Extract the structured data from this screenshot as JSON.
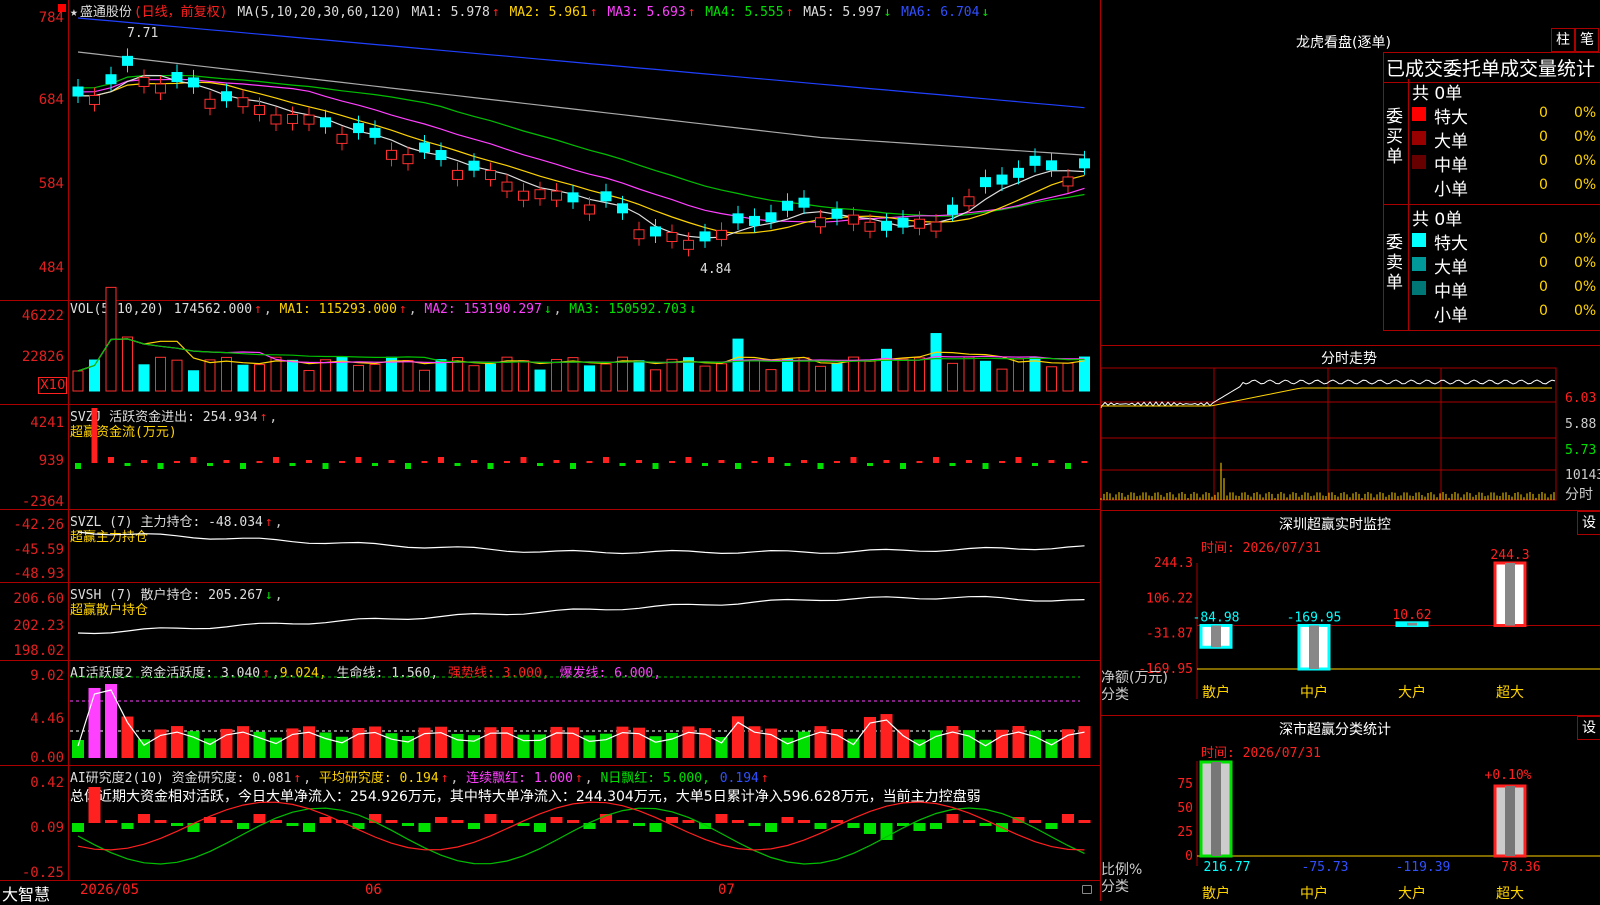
{
  "stock": {
    "star": "★",
    "name": "盛通股份",
    "period": "(日线，前复权)",
    "ma_def": "MA(5,10,20,30,60,120)"
  },
  "ma_header": [
    {
      "label": "MA1:",
      "value": "5.978",
      "arrow": "↑",
      "color": "#dddddd"
    },
    {
      "label": "MA2:",
      "value": "5.961",
      "arrow": "↑",
      "color": "#ffd400"
    },
    {
      "label": "MA3:",
      "value": "5.693",
      "arrow": "↑",
      "color": "#ff40ff"
    },
    {
      "label": "MA4:",
      "value": "5.555",
      "arrow": "↑",
      "color": "#00e000"
    },
    {
      "label": "MA5:",
      "value": "5.997",
      "arrow": "↓",
      "color": "#dddddd"
    },
    {
      "label": "MA6:",
      "value": "6.704",
      "arrow": "↓",
      "color": "#3050ff"
    }
  ],
  "price_axis": [
    "784",
    "684",
    "584",
    "484"
  ],
  "price_marks": {
    "high": "7.71",
    "low": "4.84"
  },
  "vol_header": {
    "title": "VOL(5,10,20)",
    "vol": "174562.000",
    "ma1": "MA1: 115293.000",
    "ma2": "MA2: 153190.297",
    "ma3": "MA3: 150592.703"
  },
  "vol_axis": [
    "46222",
    "22826"
  ],
  "vol_unit": "X10",
  "svzj": {
    "title": "SVZJ  活跃资金进出: 254.934",
    "sub": "超赢资金流(万元)",
    "axis": [
      "4241",
      "939",
      "-2364"
    ]
  },
  "svzl": {
    "title": "SVZL (7) 主力持仓: -48.034",
    "sub": "超赢主力持仓",
    "axis": [
      "-42.26",
      "-45.59",
      "-48.93"
    ]
  },
  "svsh": {
    "title": "SVSH (7) 散户持仓: 205.267",
    "sub": "超赢散户持仓",
    "axis": [
      "206.60",
      "202.23",
      "198.02"
    ]
  },
  "ai1": {
    "title": "AI活跃度2 资金活跃度: 3.040",
    "v2": "9.024,",
    "life": "生命线: 1.560,",
    "strong": "强势线: 3.000,",
    "burst": "爆发线: 6.000,",
    "axis": [
      "9.02",
      "4.46",
      "0.00"
    ]
  },
  "ai2": {
    "title": "AI研究度2(10) 资金研究度: 0.081",
    "avg": "平均研究度: 0.194",
    "cont": "连续飘红: 1.000",
    "nday": "N日飘红: 5.000,",
    "last": "0.194",
    "axis": [
      "0.42",
      "0.09",
      "-0.25"
    ],
    "summary": "总体近期大资金相对活跃，今日大单净流入：254.926万元，其中特大单净流入：244.304万元，大单5日累计净入596.628万元，当前主力控盘弱"
  },
  "bottom": {
    "brand": "大智慧",
    "dates": [
      "2026/05",
      "06",
      "07"
    ]
  },
  "lhb": {
    "title": "龙虎看盘(逐单)",
    "tab1": "柱",
    "tab2": "笔",
    "header": "已成交委托单成交量统计",
    "buy": {
      "label": "委买单",
      "total": "共 0单",
      "rows": [
        {
          "n": "特大",
          "c": "0",
          "p": "0%",
          "color": "#ff0000"
        },
        {
          "n": "大单",
          "c": "0",
          "p": "0%",
          "color": "#990000"
        },
        {
          "n": "中单",
          "c": "0",
          "p": "0%",
          "color": "#660000"
        },
        {
          "n": "小单",
          "c": "0",
          "p": "0%",
          "color": "#000000"
        }
      ]
    },
    "sell": {
      "label": "委卖单",
      "total": "共 0单",
      "rows": [
        {
          "n": "特大",
          "c": "0",
          "p": "0%",
          "color": "#00ffff"
        },
        {
          "n": "大单",
          "c": "0",
          "p": "0%",
          "color": "#009999"
        },
        {
          "n": "中单",
          "c": "0",
          "p": "0%",
          "color": "#007777"
        },
        {
          "n": "小单",
          "c": "0",
          "p": "0%",
          "color": "#000000"
        }
      ]
    }
  },
  "intraday": {
    "title": "分时走势",
    "axis": [
      "6.03",
      "5.88",
      "5.73"
    ],
    "vol_label": "10143",
    "vol_unit": "分时"
  },
  "monitor": {
    "title": "深圳超赢实时监控",
    "set": "设",
    "time": "时间: 2026/07/31",
    "axis": [
      "244.3",
      "106.22",
      "-31.87",
      "-169.95"
    ],
    "ylabel": "净额(万元)",
    "xlabel": "分类",
    "categories": [
      "散户",
      "中户",
      "大户",
      "超大"
    ],
    "values": [
      -84.98,
      -169.95,
      10.62,
      244.3
    ],
    "labels": [
      "-84.98",
      "-169.95",
      "10.62",
      "244.3"
    ]
  },
  "classstat": {
    "title": "深市超赢分类统计",
    "set": "设",
    "time": "时间: 2026/07/31",
    "axis": [
      "75",
      "50",
      "25",
      "0"
    ],
    "ylabel": "比例%",
    "xlabel": "分类",
    "categories": [
      "散户",
      "中户",
      "大户",
      "超大"
    ],
    "labels": [
      "216.77",
      "-75.73",
      "-119.39",
      "78.36"
    ],
    "top_label": "+0.10%"
  },
  "chart_data": {
    "type": "bar",
    "title": "深圳超赢实时监控",
    "categories": [
      "散户",
      "中户",
      "大户",
      "超大"
    ],
    "values": [
      -84.98,
      -169.95,
      10.62,
      244.3
    ],
    "ylabel": "净额(万元)",
    "xlabel": "分类",
    "ylim": [
      -169.95,
      244.3
    ]
  }
}
